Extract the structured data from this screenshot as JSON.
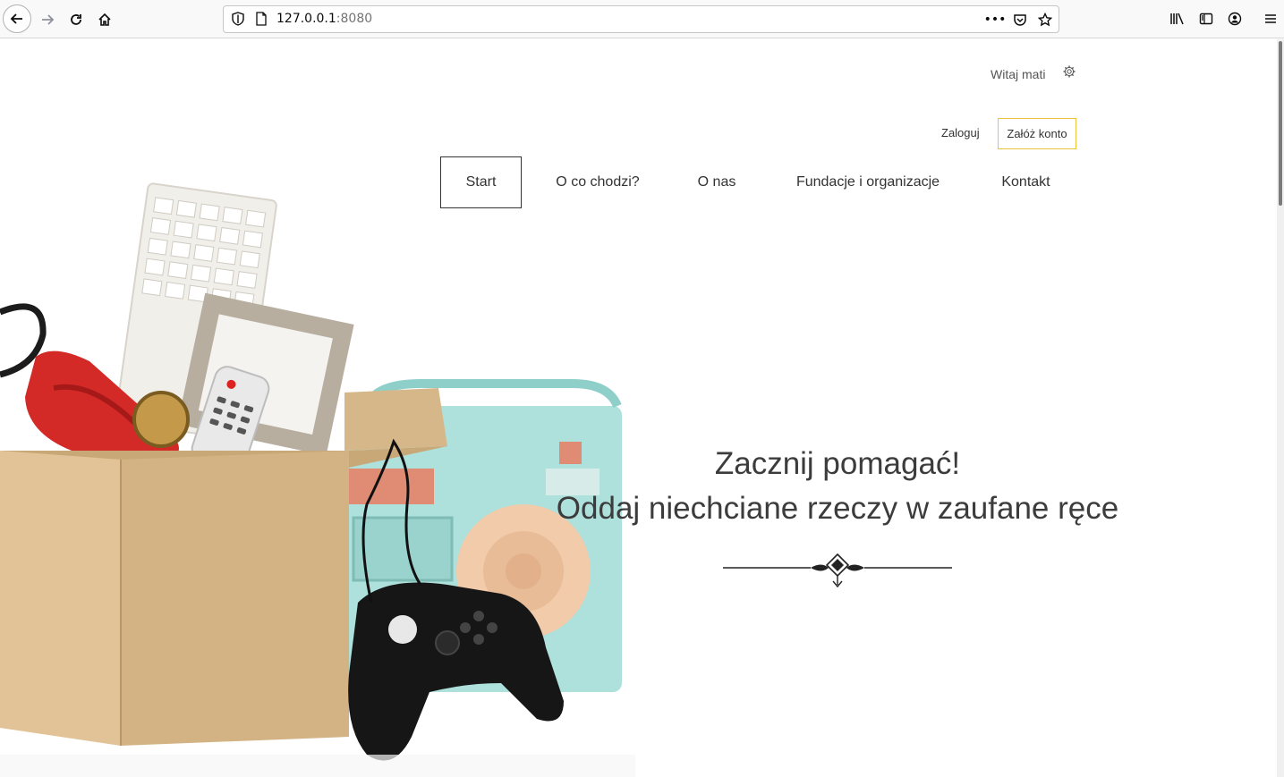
{
  "browser": {
    "url_host": "127.0.0.1",
    "url_port": ":8080"
  },
  "header": {
    "greeting": "Witaj mati",
    "login_label": "Zaloguj",
    "register_label": "Załóż konto"
  },
  "nav": {
    "items": [
      {
        "label": "Start"
      },
      {
        "label": "O co chodzi?"
      },
      {
        "label": "O nas"
      },
      {
        "label": "Fundacje i organizacje"
      },
      {
        "label": "Kontakt"
      }
    ]
  },
  "hero": {
    "title_line1": "Zacznij pomagać!",
    "title_line2": "Oddaj niechciane rzeczy w zaufane ręce"
  },
  "colors": {
    "accent_border": "#f0c23b",
    "text": "#333333"
  }
}
